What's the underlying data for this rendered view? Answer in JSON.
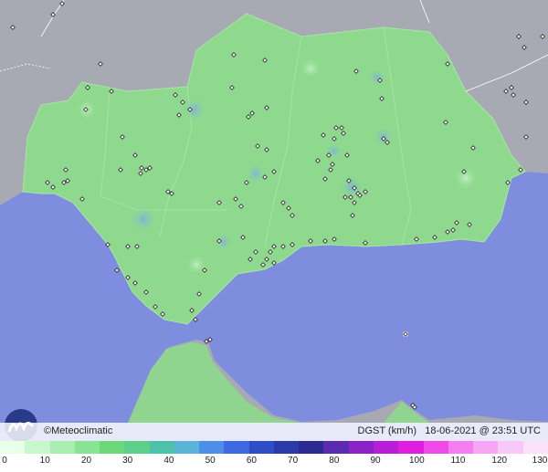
{
  "legend": {
    "brand": "©Meteoclimatic",
    "product": "DGST (km/h)",
    "datetime": "18-06-2021 @ 23:51 UTC",
    "ticks": [
      "0",
      "10",
      "20",
      "30",
      "40",
      "50",
      "60",
      "70",
      "80",
      "90",
      "100",
      "110",
      "120",
      "130"
    ],
    "colors": [
      "#e8ffe8",
      "#c8f7cc",
      "#a8eeb0",
      "#88e494",
      "#6cd878",
      "#5ccf8a",
      "#4cc2a8",
      "#5ab4d8",
      "#4d8ee8",
      "#3d6ae0",
      "#2e4ec8",
      "#2a3aa8",
      "#2a2a90",
      "#5a2ab0",
      "#8a22c8",
      "#b81ed8",
      "#e01ee0",
      "#f04ae8",
      "#f47ef0",
      "#f6a6f4",
      "#f8c8f8",
      "#fae2fa"
    ]
  },
  "colors": {
    "sea": "#7f8ddf",
    "land_andalusia": "#8ed98e",
    "land_other": "#a5a8b0"
  }
}
